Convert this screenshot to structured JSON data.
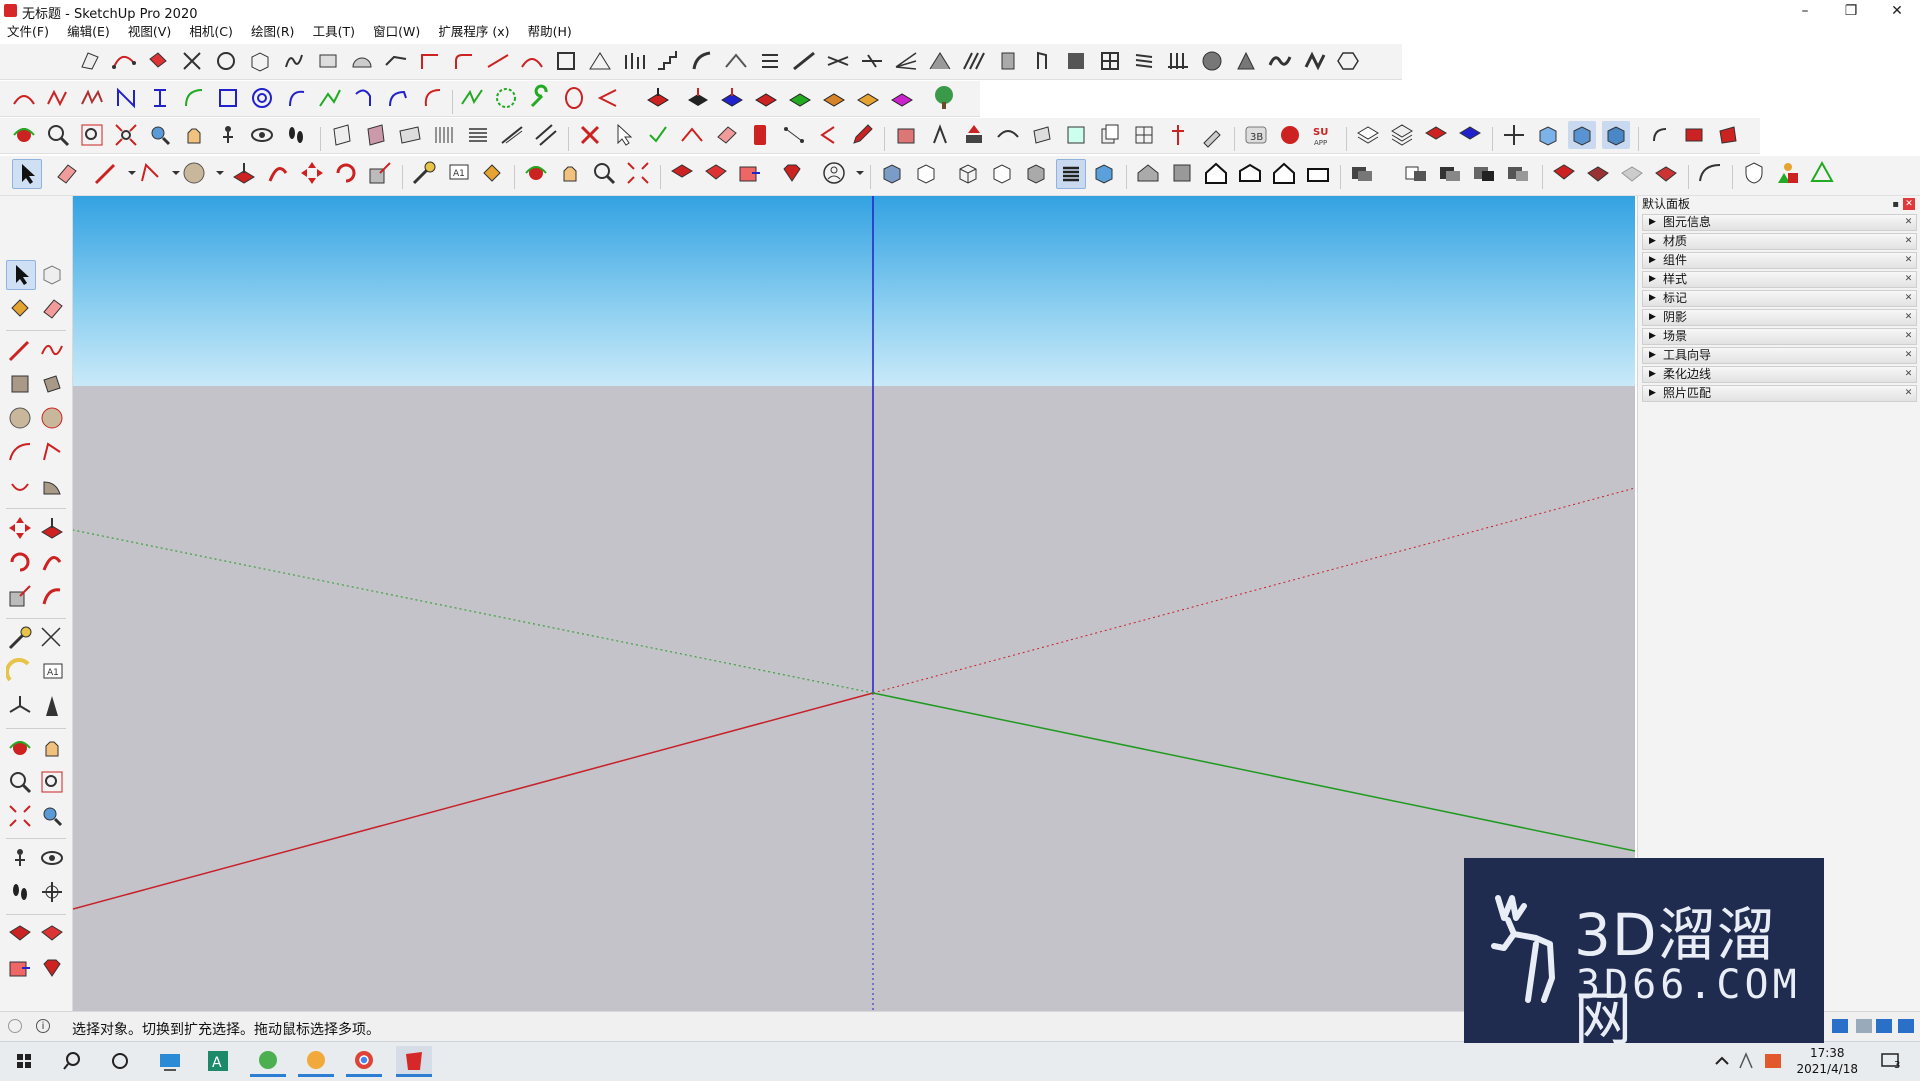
{
  "window": {
    "title": "无标题 - SketchUp Pro 2020",
    "minimize": "–",
    "restore": "❐",
    "close": "✕"
  },
  "menu": [
    {
      "label": "文件(F)"
    },
    {
      "label": "编辑(E)"
    },
    {
      "label": "视图(V)"
    },
    {
      "label": "相机(C)"
    },
    {
      "label": "绘图(R)"
    },
    {
      "label": "工具(T)"
    },
    {
      "label": "窗口(W)"
    },
    {
      "label": "扩展程序 (x)"
    },
    {
      "label": "帮助(H)"
    }
  ],
  "tray": {
    "title": "默认面板",
    "items": [
      {
        "label": "图元信息"
      },
      {
        "label": "材质"
      },
      {
        "label": "组件"
      },
      {
        "label": "样式"
      },
      {
        "label": "标记"
      },
      {
        "label": "阴影"
      },
      {
        "label": "场景"
      },
      {
        "label": "工具向导"
      },
      {
        "label": "柔化边线"
      },
      {
        "label": "照片匹配"
      }
    ]
  },
  "statusbar": {
    "message": "选择对象。切换到扩充选择。拖动鼠标选择多项。"
  },
  "taskbar": {
    "time": "17:38",
    "date": "2021/4/18",
    "notifications": "3"
  },
  "watermark": {
    "line1": "3D溜溜网",
    "line2": "3D66.COM"
  },
  "colors": {
    "axis_red": "#c8202a",
    "axis_green": "#1f9a1f",
    "axis_blue": "#2121c8",
    "sky_top": "#33a2e2",
    "ground": "#c4c3c9"
  }
}
